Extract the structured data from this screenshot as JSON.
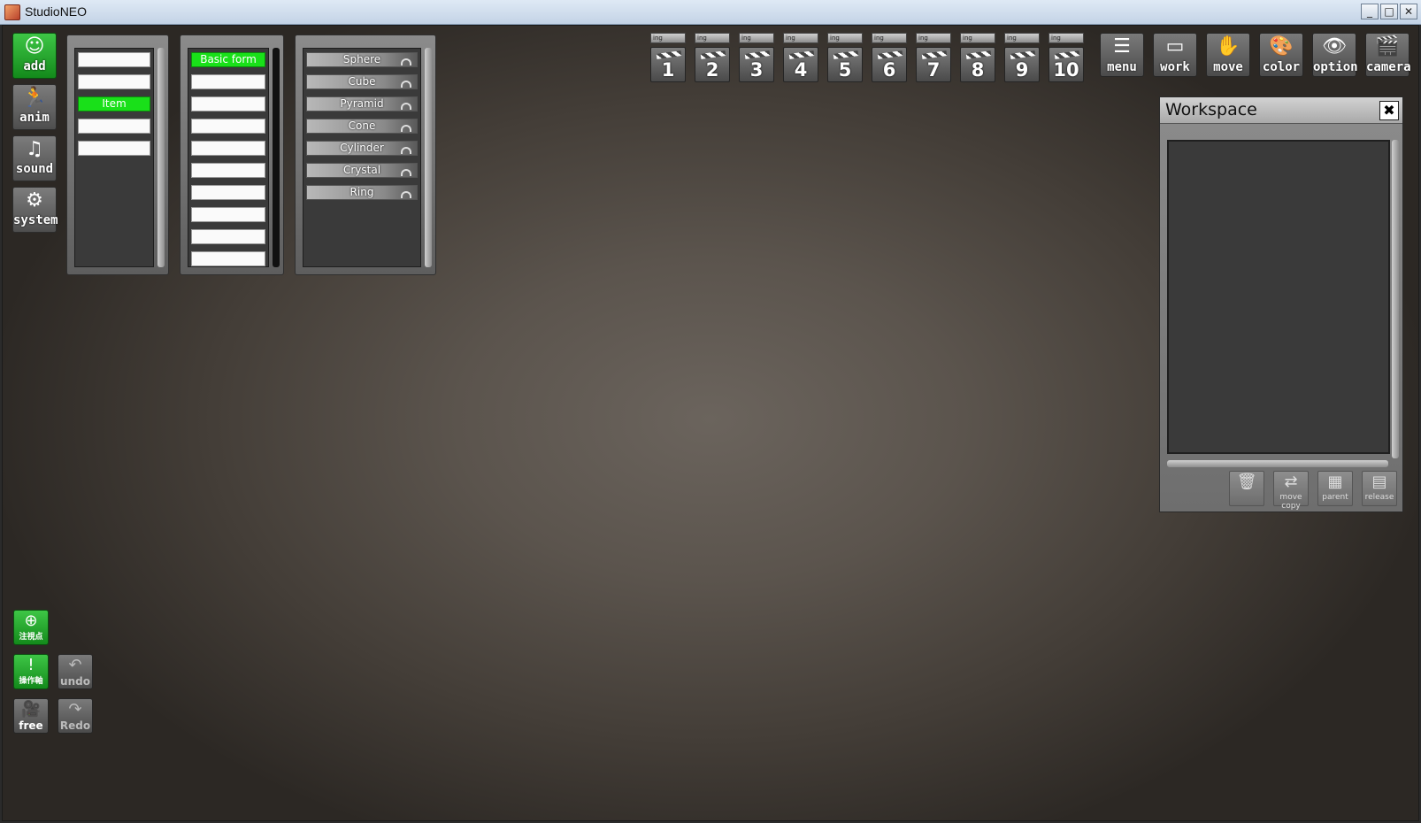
{
  "window": {
    "title": "StudioNEO",
    "buttons": [
      "_",
      "□",
      "✕"
    ]
  },
  "left_buttons": [
    {
      "label": "add",
      "icon": "person-add-icon",
      "glyph": "☺"
    },
    {
      "label": "anim",
      "icon": "running-person-icon",
      "glyph": "🏃"
    },
    {
      "label": "sound",
      "icon": "music-note-icon",
      "glyph": "♫"
    },
    {
      "label": "system",
      "icon": "gears-icon",
      "glyph": "⚙"
    }
  ],
  "list1": {
    "items": [
      "",
      "",
      "Item",
      "",
      ""
    ],
    "selected_index": 2
  },
  "list2": {
    "items": [
      "Basic form",
      "",
      "",
      "",
      "",
      "",
      "",
      "",
      "",
      ""
    ],
    "selected_index": 0
  },
  "list3": {
    "items": [
      "Sphere",
      "Cube",
      "Pyramid",
      "Cone",
      "Cylinder",
      "Crystal",
      "Ring"
    ]
  },
  "scenes": [
    {
      "tag": "ing",
      "number": "1"
    },
    {
      "tag": "ing",
      "number": "2"
    },
    {
      "tag": "ing",
      "number": "3"
    },
    {
      "tag": "ing",
      "number": "4"
    },
    {
      "tag": "ing",
      "number": "5"
    },
    {
      "tag": "ing",
      "number": "6"
    },
    {
      "tag": "ing",
      "number": "7"
    },
    {
      "tag": "ing",
      "number": "8"
    },
    {
      "tag": "ing",
      "number": "9"
    },
    {
      "tag": "ing",
      "number": "10"
    }
  ],
  "tools": [
    {
      "label": "menu",
      "icon": "list-icon",
      "glyph": "☰"
    },
    {
      "label": "work",
      "icon": "window-icon",
      "glyph": "▭"
    },
    {
      "label": "move",
      "icon": "hand-icon",
      "glyph": "✋"
    },
    {
      "label": "color",
      "icon": "palette-icon",
      "glyph": "🎨"
    },
    {
      "label": "option",
      "icon": "eye-icon",
      "glyph": "👁"
    },
    {
      "label": "camera",
      "icon": "clapperboard-icon",
      "glyph": "🎬"
    }
  ],
  "workspace": {
    "title": "Workspace",
    "close": "✖",
    "buttons": [
      {
        "label": "",
        "icon": "trash-icon",
        "glyph": "🗑"
      },
      {
        "label": "move copy",
        "icon": "move-copy-icon",
        "glyph": "⇄"
      },
      {
        "label": "parent",
        "icon": "parent-icon",
        "glyph": "▦"
      },
      {
        "label": "release",
        "icon": "release-icon",
        "glyph": "▤"
      }
    ]
  },
  "bottom_buttons": {
    "focus": {
      "label": "注視点",
      "glyph": "⊕"
    },
    "axis": {
      "label": "操作軸",
      "glyph": "!"
    },
    "undo": {
      "label": "undo",
      "glyph": "↶"
    },
    "free": {
      "label": "free",
      "glyph": "🎥"
    },
    "redo": {
      "label": "Redo",
      "glyph": "↷"
    }
  }
}
